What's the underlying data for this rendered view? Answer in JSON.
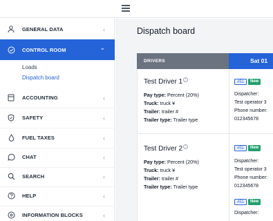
{
  "header": {
    "menu_icon": "hamburger-icon"
  },
  "sidebar": {
    "items": [
      {
        "label": "GENERAL DATA",
        "icon": "user-icon"
      },
      {
        "label": "CONTROL ROOM",
        "icon": "check-circle-icon"
      },
      {
        "label": "ACCOUNTING",
        "icon": "calculator-icon"
      },
      {
        "label": "SAFETY",
        "icon": "shield-icon"
      },
      {
        "label": "FUEL TAXES",
        "icon": "fuel-drop-icon"
      },
      {
        "label": "CHAT",
        "icon": "chat-icon"
      },
      {
        "label": "SEARCH",
        "icon": "search-icon"
      },
      {
        "label": "HELP",
        "icon": "help-icon"
      },
      {
        "label": "INFORMATION BLOCKS",
        "icon": "info-blocks-icon"
      }
    ],
    "sub_items": [
      {
        "label": "Loads"
      },
      {
        "label": "Dispatch board"
      }
    ],
    "chevron_collapsed": "‹",
    "chevron_expanded": "⌄"
  },
  "main": {
    "title": "Dispatch board",
    "table": {
      "drivers_header": "DRIVERS",
      "day_header": "Sat 01",
      "drivers": [
        {
          "name": "Test Driver 1",
          "pay_type_label": "Pay type:",
          "pay_type": "Percent (20%)",
          "truck_label": "Truck:",
          "truck": "truck ¥",
          "trailer_label": "Trailer:",
          "trailer": "trailer #",
          "trailer_type_label": "Trailer type:",
          "trailer_type": "Trailer type",
          "loads": [
            {
              "id": "#51",
              "status": "New",
              "dispatcher_label": "Dispatcher:",
              "dispatcher": "Test operator 3",
              "phone_label": "Phone number:",
              "phone": "012345678"
            }
          ]
        },
        {
          "name": "Test Driver 2",
          "pay_type_label": "Pay type:",
          "pay_type": "Percent (20%)",
          "truck_label": "Truck:",
          "truck": "truck ¥",
          "trailer_label": "Trailer:",
          "trailer": "trailer #",
          "trailer_type_label": "Trailer type:",
          "trailer_type": "Trailer type",
          "loads": [
            {
              "id": "#51",
              "status": "New",
              "dispatcher_label": "Dispatcher:",
              "dispatcher": "Test operator 3",
              "phone_label": "Phone number:",
              "phone": "012345678"
            },
            {
              "id": "#51",
              "status": "New",
              "dispatcher_label": "Dispatcher:"
            }
          ]
        }
      ]
    }
  },
  "colors": {
    "accent": "#2563d9",
    "status_new": "#22a06b",
    "header_gray": "#6b7280"
  }
}
